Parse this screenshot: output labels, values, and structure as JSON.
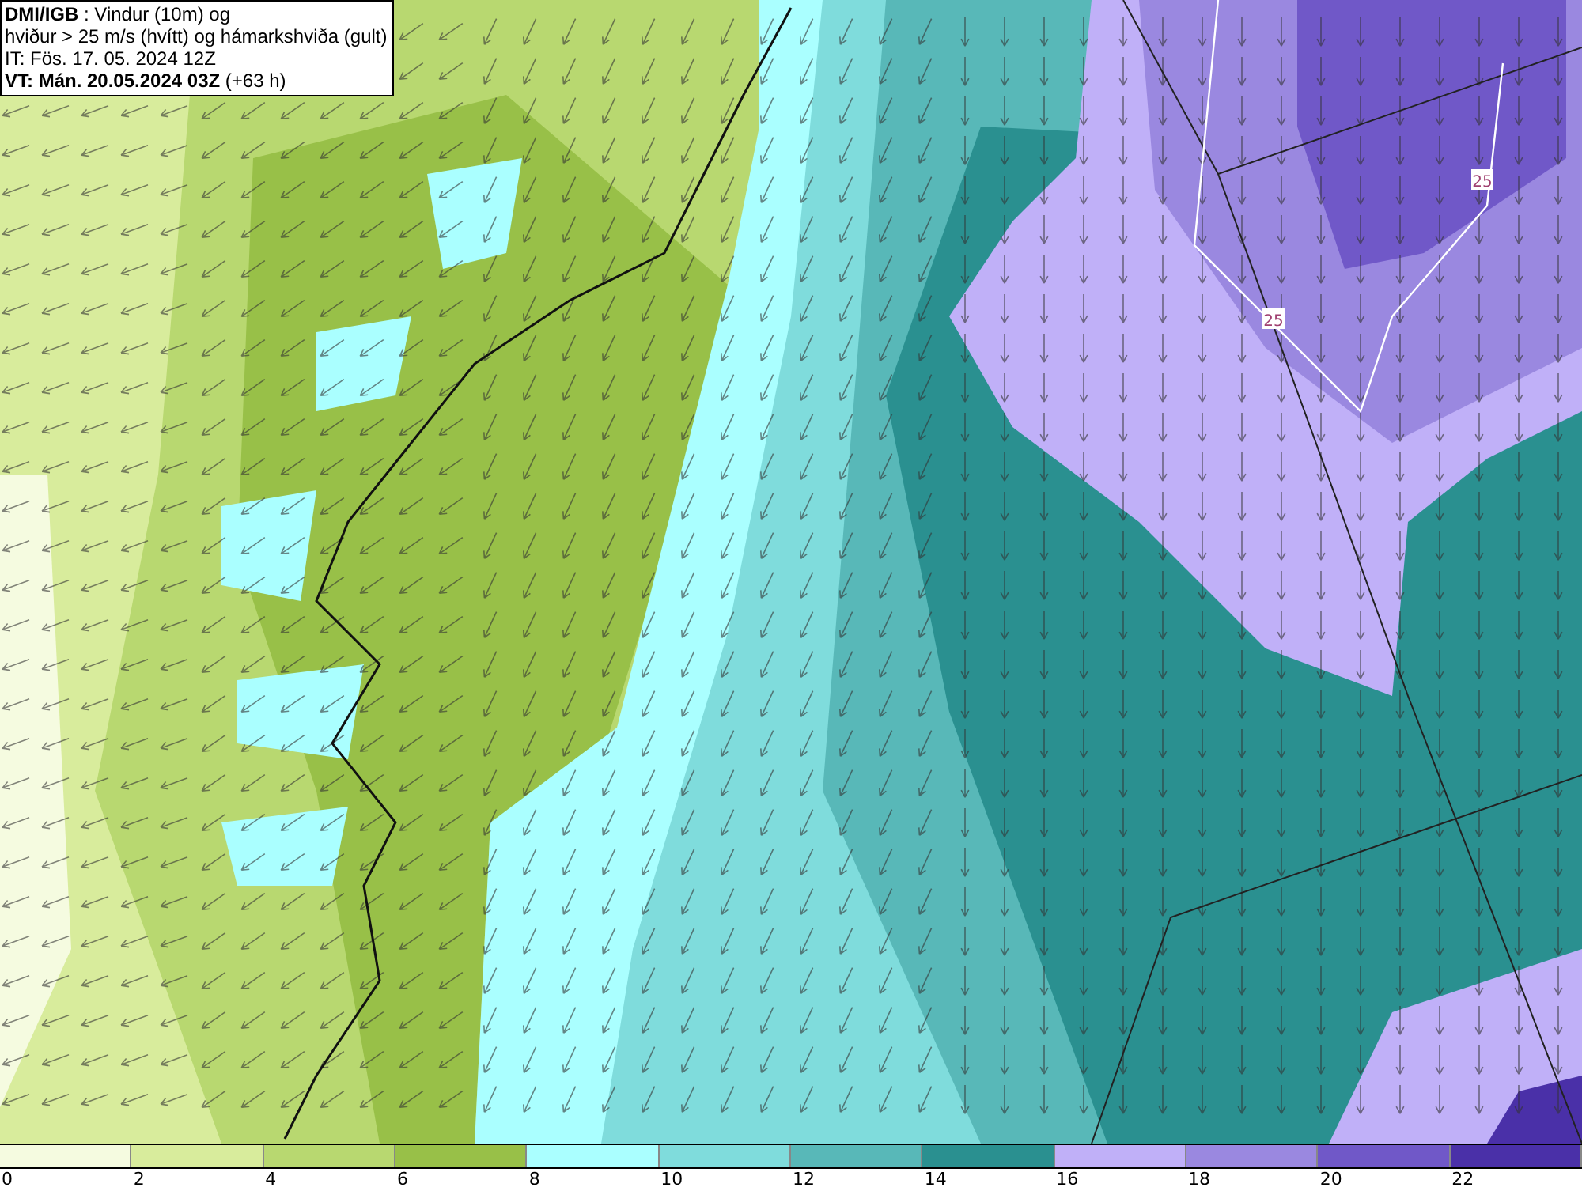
{
  "header": {
    "lines": [
      "**DMI/IGB** : Vindur (10m) og",
      "hviður > 25 m/s (hvítt) og hámarkshviða (gult)",
      "IT: Fös. 17. 05. 2024 12Z",
      "**VT: Mán. 20.05.2024 03Z** (+63 h)"
    ]
  },
  "map": {
    "contour_labels": [
      "25",
      "25"
    ]
  },
  "legend": {
    "bins": [
      {
        "color": "#f5fbe0"
      },
      {
        "color": "#d8ec9c"
      },
      {
        "color": "#b8d870"
      },
      {
        "color": "#98c048"
      },
      {
        "color": "#aaffff"
      },
      {
        "color": "#7fdcdc"
      },
      {
        "color": "#58b8b8"
      },
      {
        "color": "#2a9090"
      },
      {
        "color": "#c0b0f8"
      },
      {
        "color": "#9a88e0"
      },
      {
        "color": "#7058c8"
      },
      {
        "color": "#4a30a8"
      }
    ],
    "ticks": [
      "0",
      "2",
      "4",
      "6",
      "8",
      "10",
      "12",
      "14",
      "16",
      "18",
      "20",
      "22"
    ]
  }
}
